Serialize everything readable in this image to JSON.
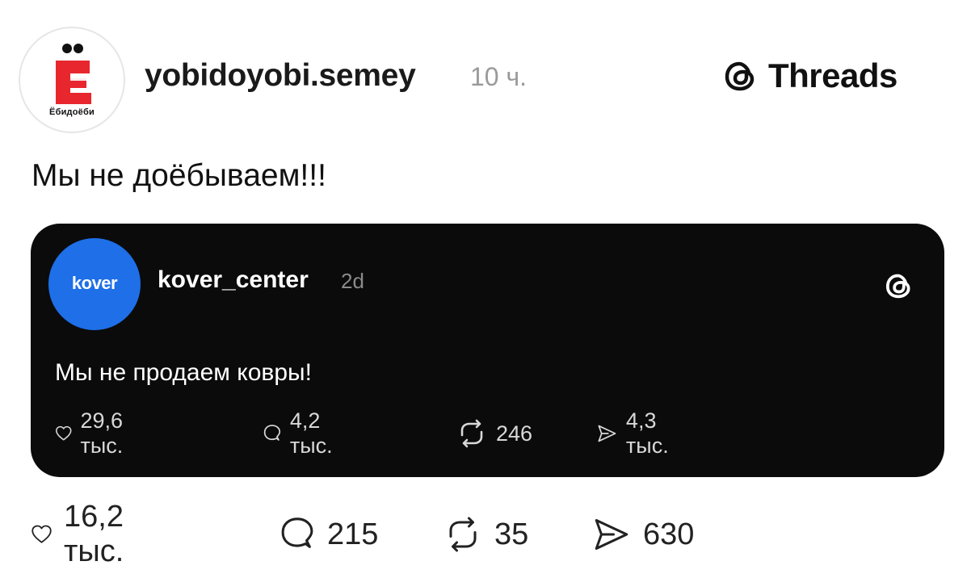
{
  "header": {
    "avatar_brand": "Ёбидоёби",
    "username": "yobidoyobi.semey",
    "time": "10 ч.",
    "app_name": "Threads"
  },
  "post": {
    "text": "Мы не доёбываем!!!"
  },
  "quoted": {
    "avatar_text": "kover",
    "username": "kover_center",
    "time": "2d",
    "text": "Мы не продаем ковры!",
    "likes": "29,6 тыс.",
    "comments": "4,2 тыс.",
    "reposts": "246",
    "shares": "4,3 тыс."
  },
  "stats": {
    "likes": "16,2 тыс.",
    "comments": "215",
    "reposts": "35",
    "shares": "630"
  },
  "colors": {
    "brand_red": "#e8262e",
    "kover_blue": "#1e6fe8",
    "card_bg": "#0b0b0b"
  },
  "icons": [
    "heart-icon",
    "comment-icon",
    "repost-icon",
    "share-icon",
    "threads-icon"
  ]
}
